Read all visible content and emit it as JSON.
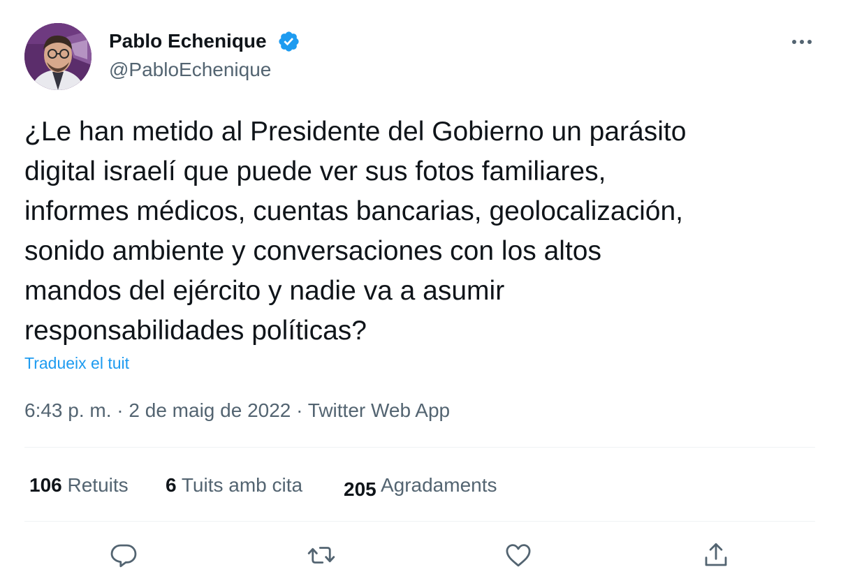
{
  "author": {
    "name": "Pablo Echenique",
    "handle": "@PabloEchenique",
    "verified": true
  },
  "tweet": {
    "text": "¿Le han metido al Presidente del Gobierno un parásito\ndigital israelí que puede ver sus fotos familiares,\ninformes médicos, cuentas bancarias, geolocalización,\nsonido ambiente y conversaciones con los altos\nmandos del ejército y nadie va a asumir\nresponsabilidades políticas?",
    "translate_label": "Tradueix el tuit"
  },
  "meta": {
    "time": "6:43 p. m.",
    "separator": " · ",
    "date": "2 de maig de 2022",
    "source": "Twitter Web App"
  },
  "stats": {
    "retweets": {
      "count": "106",
      "label": "Retuits"
    },
    "quotes": {
      "count": "6",
      "label": "Tuits amb cita"
    },
    "likes": {
      "count": "205",
      "label": "Agradaments"
    }
  },
  "actions": [
    "reply-icon",
    "retweet-icon",
    "like-icon",
    "share-icon"
  ],
  "colors": {
    "text": "#0f1419",
    "secondary": "#536471",
    "link": "#1d9bf0",
    "verified": "#1d9bf0",
    "divider": "#eff3f4"
  }
}
